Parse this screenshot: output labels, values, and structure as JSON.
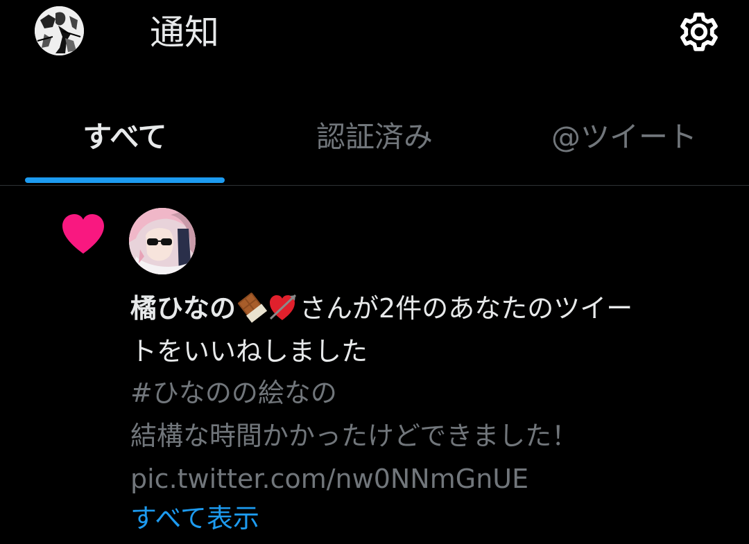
{
  "header": {
    "title": "通知",
    "avatar_icon": "profile-avatar",
    "settings_icon": "gear-icon"
  },
  "tabs": [
    {
      "label": "すべて",
      "active": true
    },
    {
      "label": "認証済み",
      "active": false
    },
    {
      "label": "@ツイート",
      "active": false
    }
  ],
  "notification": {
    "type_icon": "heart-icon",
    "user_name": "橘ひなの",
    "name_emojis": [
      "chocolate-bar-emoji",
      "heart-with-arrow-emoji"
    ],
    "message_line1": "さんが2件のあなたのツイー",
    "message_line2": "トをいいねしました",
    "tweet_lines": [
      "#ひなのの絵なの",
      "結構な時間かかったけどできました！",
      "pic.twitter.com/nw0NNmGnUE"
    ],
    "show_all_label": "すべて表示"
  },
  "colors": {
    "background": "#000000",
    "primary_text": "#e7e9ea",
    "secondary_text": "#71767b",
    "accent": "#1d9bf0",
    "like": "#f91880",
    "divider": "#2f3336"
  }
}
